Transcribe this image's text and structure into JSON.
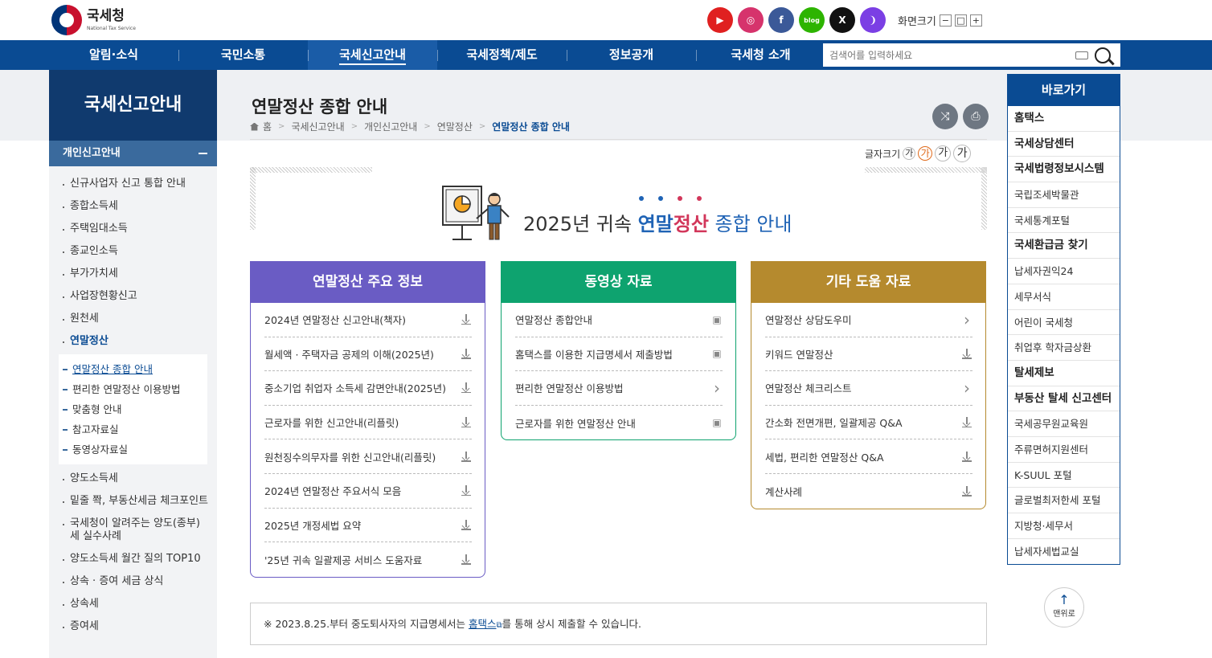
{
  "header": {
    "logo_ko": "국세청",
    "logo_en": "National Tax Service",
    "sns": [
      {
        "name": "youtube",
        "color": "#e02020",
        "glyph": "▶"
      },
      {
        "name": "instagram",
        "color": "#d6336c",
        "glyph": "◎"
      },
      {
        "name": "facebook",
        "color": "#3b5998",
        "glyph": "f"
      },
      {
        "name": "blog",
        "color": "#2db400",
        "glyph": "blog"
      },
      {
        "name": "x",
        "color": "#111111",
        "glyph": "X"
      },
      {
        "name": "kakao-story",
        "color": "#7b3fe4",
        "glyph": "❩"
      }
    ],
    "font_size_label": "화면크기",
    "font_size_minus": "−",
    "font_size_reset": "□",
    "font_size_plus": "+"
  },
  "gnb": {
    "items": [
      "알림·소식",
      "국민소통",
      "국세신고안내",
      "국세정책/제도",
      "정보공개",
      "국세청 소개"
    ],
    "active_index": 2,
    "search_placeholder": "검색어를 입력하세요"
  },
  "lnb": {
    "title": "국세신고안내",
    "section": "개인신고안내",
    "items_before": [
      "신규사업자 신고 통합 안내",
      "종합소득세",
      "주택임대소득",
      "종교인소득",
      "부가가치세",
      "사업장현황신고",
      "원천세"
    ],
    "current": "연말정산",
    "sub_items": [
      "연말정산 종합 안내",
      "편리한 연말정산 이용방법",
      "맞춤형 안내",
      "참고자료실",
      "동영상자료실"
    ],
    "items_after": [
      "양도소득세",
      "밑줄 쫙, 부동산세금 체크포인트",
      "국세청이 알려주는 양도(종부)세 실수사례",
      "양도소득세 월간 질의 TOP10",
      "상속 · 증여 세금 상식",
      "상속세",
      "증여세"
    ]
  },
  "page": {
    "title": "연말정산 종합 안내",
    "breadcrumb": [
      "홈",
      "국세신고안내",
      "개인신고안내",
      "연말정산",
      "연말정산 종합 안내"
    ],
    "text_size_label": "글자크기",
    "text_size_options": [
      "가",
      "가",
      "가",
      "가"
    ]
  },
  "banner": {
    "prefix": "2025년 귀속 ",
    "word1": "연말",
    "word2": "정산",
    "suffix": " 종합 안내",
    "dot_colors": [
      "#1f63b5",
      "#1f63b5",
      "#d2365a",
      "#d2365a"
    ]
  },
  "cards": [
    {
      "title": "연말정산 주요 정보",
      "color": "#6a5cc4",
      "items": [
        {
          "label": "2024년 연말정산 신고안내(책자)",
          "icon": "download-icon"
        },
        {
          "label": "월세액 · 주택자금 공제의 이해(2025년)",
          "icon": "download-icon"
        },
        {
          "label": "중소기업 취업자 소득세 감면안내(2025년)",
          "icon": "download-icon"
        },
        {
          "label": "근로자를 위한 신고안내(리플릿)",
          "icon": "download-icon"
        },
        {
          "label": "원천징수의무자를 위한 신고안내(리플릿)",
          "icon": "download-icon"
        },
        {
          "label": "2024년 연말정산 주요서식 모음",
          "icon": "download-icon"
        },
        {
          "label": "2025년 개정세법 요약",
          "icon": "download-icon"
        },
        {
          "label": "'25년 귀속 일괄제공 서비스 도움자료",
          "icon": "download-icon"
        }
      ]
    },
    {
      "title": "동영상 자료",
      "color": "#0ea36f",
      "items": [
        {
          "label": "연말정산 종합안내",
          "icon": "video-icon"
        },
        {
          "label": "홈택스를 이용한 지급명세서 제출방법",
          "icon": "video-icon"
        },
        {
          "label": "편리한 연말정산 이용방법",
          "icon": "chevron-right-icon"
        },
        {
          "label": "근로자를 위한 연말정산 안내",
          "icon": "video-icon"
        }
      ]
    },
    {
      "title": "기타 도움 자료",
      "color": "#b58a2e",
      "items": [
        {
          "label": "연말정산 상담도우미",
          "icon": "chevron-right-icon"
        },
        {
          "label": "키워드 연말정산",
          "icon": "download-icon"
        },
        {
          "label": "연말정산 체크리스트",
          "icon": "chevron-right-icon"
        },
        {
          "label": "간소화 전면개편, 일괄제공 Q&A",
          "icon": "download-icon"
        },
        {
          "label": "세법, 편리한 연말정산 Q&A",
          "icon": "download-icon"
        },
        {
          "label": "계산사례",
          "icon": "download-icon"
        }
      ]
    }
  ],
  "notice": {
    "prefix": "※ 2023.8.25.부터 중도퇴사자의 지급명세서는 ",
    "link": "홈택스",
    "suffix": "를 통해 상시 제출할 수 있습니다."
  },
  "quick": {
    "title": "바로가기",
    "items": [
      {
        "label": "홈택스",
        "bold": true
      },
      {
        "label": "국세상담센터",
        "bold": true
      },
      {
        "label": "국세법령정보시스템",
        "bold": true
      },
      {
        "label": "국립조세박물관",
        "bold": false
      },
      {
        "label": "국세통계포털",
        "bold": false
      },
      {
        "label": "국세환급금 찾기",
        "bold": true
      },
      {
        "label": "납세자권익24",
        "bold": false
      },
      {
        "label": "세무서식",
        "bold": false
      },
      {
        "label": "어린이 국세청",
        "bold": false
      },
      {
        "label": "취업후 학자금상환",
        "bold": false
      },
      {
        "label": "탈세제보",
        "bold": true
      },
      {
        "label": "부동산 탈세 신고센터",
        "bold": true
      },
      {
        "label": "국세공무원교육원",
        "bold": false
      },
      {
        "label": "주류면허지원센터",
        "bold": false
      },
      {
        "label": "K-SUUL 포털",
        "bold": false
      },
      {
        "label": "글로벌최저한세 포털",
        "bold": false
      },
      {
        "label": "지방청·세무서",
        "bold": false
      },
      {
        "label": "납세자세법교실",
        "bold": false
      }
    ],
    "to_top": "맨위로"
  }
}
